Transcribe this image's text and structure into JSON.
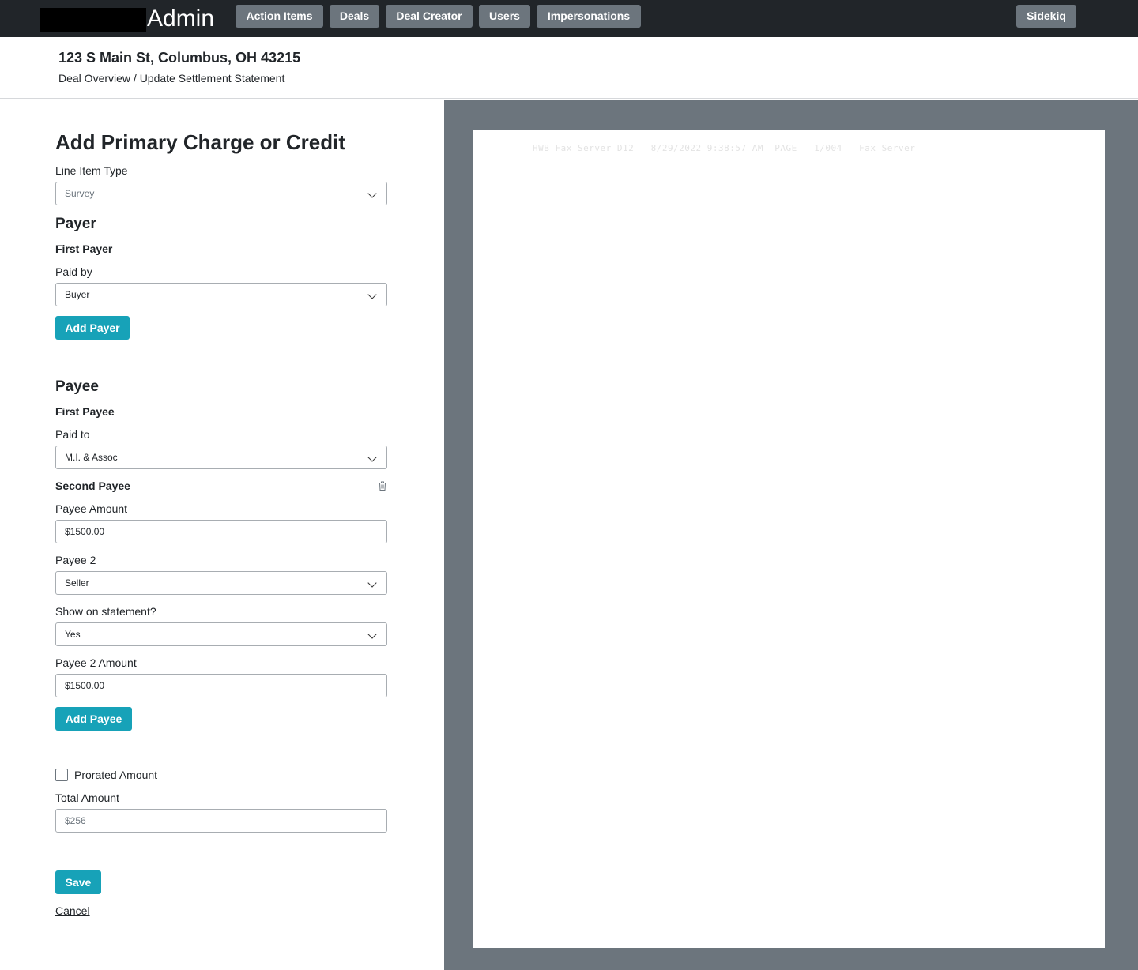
{
  "nav": {
    "brand": "Admin",
    "items": [
      {
        "label": "Action Items"
      },
      {
        "label": "Deals"
      },
      {
        "label": "Deal Creator"
      },
      {
        "label": "Users"
      },
      {
        "label": "Impersonations"
      }
    ],
    "right_label": "Sidekiq"
  },
  "header": {
    "address": "123 S Main St, Columbus, OH 43215",
    "breadcrumb": "Deal Overview / Update Settlement Statement"
  },
  "form": {
    "title": "Add Primary Charge or Credit",
    "line_item_type_label": "Line Item Type",
    "line_item_type_value": "Survey",
    "payer_heading": "Payer",
    "first_payer_label": "First Payer",
    "paid_by_label": "Paid by",
    "paid_by_value": "Buyer",
    "add_payer_label": "Add Payer",
    "payee_heading": "Payee",
    "first_payee_label": "First Payee",
    "paid_to_label": "Paid to",
    "paid_to_value": "M.I. & Assoc",
    "second_payee_label": "Second Payee",
    "payee_amount_label": "Payee Amount",
    "payee_amount_value": "$1500.00",
    "payee2_label": "Payee 2",
    "payee2_value": "Seller",
    "show_on_statement_label": "Show on statement?",
    "show_on_statement_value": "Yes",
    "payee2_amount_label": "Payee 2 Amount",
    "payee2_amount_value": "$1500.00",
    "add_payee_label": "Add Payee",
    "prorated_label": "Prorated Amount",
    "prorated_checked": false,
    "total_amount_label": "Total Amount",
    "total_amount_placeholder": "$256",
    "save_label": "Save",
    "cancel_label": "Cancel"
  },
  "document": {
    "fax_header": "HWB Fax Server D12   8/29/2022 9:38:57 AM  PAGE   1/004   Fax Server"
  },
  "colors": {
    "topbar": "#212529",
    "nav_button": "#6c757d",
    "primary_button": "#17a2b8",
    "viewer_bg": "#6c757d"
  },
  "icons": {
    "select_chevron": "chevron-down-icon",
    "delete_payee": "trash-icon"
  }
}
